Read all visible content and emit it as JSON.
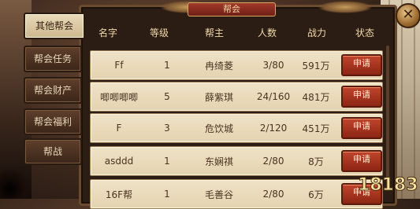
{
  "window": {
    "title": "帮会"
  },
  "tabs": [
    {
      "label": "其他帮会",
      "active": true
    },
    {
      "label": "帮会任务",
      "active": false
    },
    {
      "label": "帮会财产",
      "active": false
    },
    {
      "label": "帮会福利",
      "active": false
    },
    {
      "label": "帮战",
      "active": false
    }
  ],
  "table": {
    "columns": [
      "名字",
      "等级",
      "帮主",
      "人数",
      "战力",
      "状态"
    ],
    "rows": [
      {
        "name": "Ff",
        "level": "1",
        "leader": "冉绮菱",
        "members": "3/80",
        "power": "591万",
        "action": "申请"
      },
      {
        "name": "唧唧唧唧",
        "level": "5",
        "leader": "薛紫琪",
        "members": "24/160",
        "power": "481万",
        "action": "申请"
      },
      {
        "name": "F",
        "level": "3",
        "leader": "危饮城",
        "members": "2/120",
        "power": "451万",
        "action": "申请"
      },
      {
        "name": "asddd",
        "level": "1",
        "leader": "东娴祺",
        "members": "2/80",
        "power": "8万",
        "action": "申请"
      },
      {
        "name": "16F帮",
        "level": "1",
        "leader": "毛善谷",
        "members": "2/80",
        "power": "6万",
        "action": "申请"
      }
    ]
  },
  "close": {
    "symbol": "✕"
  },
  "watermark": {
    "text": "18183",
    "color": "#f4e4a0"
  }
}
